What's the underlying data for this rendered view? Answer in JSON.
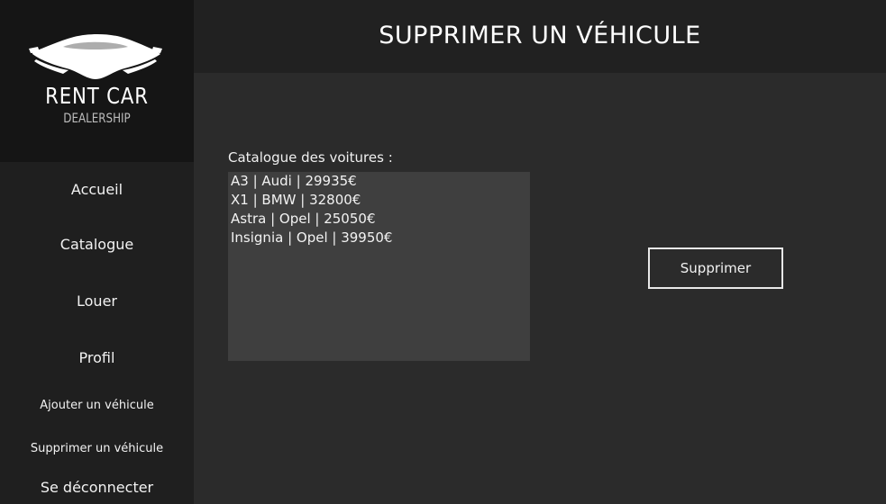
{
  "brand": {
    "title": "RENT CAR",
    "subtitle": "DEALERSHIP",
    "logo_icon": "sports-car-icon"
  },
  "header": {
    "title": "SUPPRIMER UN VÉHICULE"
  },
  "nav": {
    "items": [
      {
        "label": "Accueil"
      },
      {
        "label": "Catalogue"
      },
      {
        "label": "Louer"
      },
      {
        "label": "Profil"
      },
      {
        "label": "Ajouter un véhicule"
      },
      {
        "label": "Supprimer un véhicule"
      },
      {
        "label": "Se déconnecter"
      }
    ]
  },
  "main": {
    "list_label": "Catalogue des voitures :",
    "cars": [
      "A3 | Audi | 29935€",
      "X1 | BMW | 32800€",
      "Astra | Opel | 25050€",
      "Insignia | Opel | 39950€"
    ],
    "delete_button": "Supprimer"
  },
  "colors": {
    "sidebar": "#1f1f1f",
    "logo_bg": "#151515",
    "header": "#212121",
    "main": "#2b2b2b",
    "listbox": "#3f3f3f"
  }
}
